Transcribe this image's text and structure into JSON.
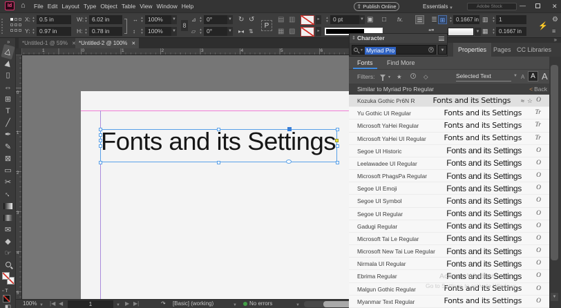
{
  "menubar": {
    "logo": "Id",
    "menus": [
      "File",
      "Edit",
      "Layout",
      "Type",
      "Object",
      "Table",
      "View",
      "Window",
      "Help"
    ],
    "publish_online": "Publish Online",
    "workspace": "Essentials",
    "stock_search_placeholder": "Adobe Stock"
  },
  "controlbar": {
    "x_label": "X:",
    "x_value": "0.5 in",
    "y_label": "Y:",
    "y_value": "0.97 in",
    "w_label": "W:",
    "w_value": "6.02 in",
    "h_label": "H:",
    "h_value": "0.78 in",
    "scale_x": "100%",
    "scale_y": "100%",
    "rotation": "0°",
    "shear": "0°",
    "stroke_weight": "0 pt",
    "wrap_offset": "0.1667 in",
    "columns": "1",
    "gutter": "0.1667 in",
    "fx_label": "fx."
  },
  "doc_tabs": [
    {
      "label": "*Untitled-1 @ 59%"
    },
    {
      "label": "*Untitled-2 @ 100%"
    }
  ],
  "rulers": {
    "h": [
      "1",
      "0",
      "1",
      "2",
      "3",
      "4",
      "5",
      "6"
    ],
    "v": [
      "0",
      "1",
      "2",
      "3",
      "4",
      "5"
    ]
  },
  "toolbar": {
    "tools": [
      {
        "name": "selection-tool",
        "glyph": "▷",
        "rot": -75,
        "active": true
      },
      {
        "name": "direct-selection-tool",
        "glyph": "▶",
        "rot": -75
      },
      {
        "name": "page-tool",
        "glyph": "▯"
      },
      {
        "name": "gap-tool",
        "glyph": "⇔"
      },
      {
        "name": "content-collector-tool",
        "glyph": "⊞"
      },
      {
        "name": "type-tool",
        "glyph": "T"
      },
      {
        "name": "line-tool",
        "glyph": "╱"
      },
      {
        "name": "pen-tool",
        "glyph": "✒"
      },
      {
        "name": "pencil-tool",
        "glyph": "✎"
      },
      {
        "name": "rectangle-frame-tool",
        "glyph": "⊠"
      },
      {
        "name": "rectangle-tool",
        "glyph": "▭"
      },
      {
        "name": "scissors-tool",
        "glyph": "✂"
      },
      {
        "name": "free-transform-tool",
        "glyph": "↔",
        "rot": 45
      },
      {
        "name": "gradient-swatch-tool",
        "css": "grad"
      },
      {
        "name": "gradient-feather-tool",
        "css": "feather"
      },
      {
        "name": "note-tool",
        "glyph": "✉"
      },
      {
        "name": "color-theme-tool",
        "glyph": "◆"
      },
      {
        "name": "hand-tool",
        "glyph": "☞"
      },
      {
        "name": "zoom-tool",
        "css": "zoomg"
      }
    ]
  },
  "canvas": {
    "frame_text": "Fonts and its Settings"
  },
  "character_panel": {
    "title": "Character",
    "search_value": "Myriad Pro",
    "tabs": [
      "Fonts",
      "Find More"
    ],
    "filters_label": "Filters:",
    "selected_text_label": "Selected Text",
    "back_label": "Back",
    "similar_header": "Similar to Myriad Pro Regular",
    "preview_text": "Fonts and its Settings",
    "fonts": [
      {
        "name": "Kozuka Gothic Pr6N R",
        "type": "O",
        "selected": true
      },
      {
        "name": "Yu Gothic UI Regular",
        "type": "Tr"
      },
      {
        "name": "Microsoft YaHei Regular",
        "type": "Tr"
      },
      {
        "name": "Microsoft YaHei UI Regular",
        "type": "Tr"
      },
      {
        "name": "Segoe UI Historic",
        "type": "O"
      },
      {
        "name": "Leelawadee UI Regular",
        "type": "O"
      },
      {
        "name": "Microsoft PhagsPa Regular",
        "type": "O"
      },
      {
        "name": "Segoe UI Emoji",
        "type": "O"
      },
      {
        "name": "Segoe UI Symbol",
        "type": "O"
      },
      {
        "name": "Segoe UI Regular",
        "type": "O"
      },
      {
        "name": "Gadugi Regular",
        "type": "O"
      },
      {
        "name": "Microsoft Tai Le Regular",
        "type": "O"
      },
      {
        "name": "Microsoft New Tai Lue Regular",
        "type": "O"
      },
      {
        "name": "Nirmala UI Regular",
        "type": "O"
      },
      {
        "name": "Ebrima Regular",
        "type": "O"
      },
      {
        "name": "Malgun Gothic Regular",
        "type": "O"
      },
      {
        "name": "Myanmar Text Regular",
        "type": "O"
      }
    ]
  },
  "dock": {
    "tabs": [
      "Properties",
      "Pages",
      "CC Libraries"
    ]
  },
  "statusbar": {
    "zoom": "100%",
    "page": "1",
    "preset": "[Basic] (working)",
    "errors": "No errors"
  },
  "watermark": {
    "line1": "Activate Windows",
    "line2": "Go to Settings to activate Windows"
  }
}
